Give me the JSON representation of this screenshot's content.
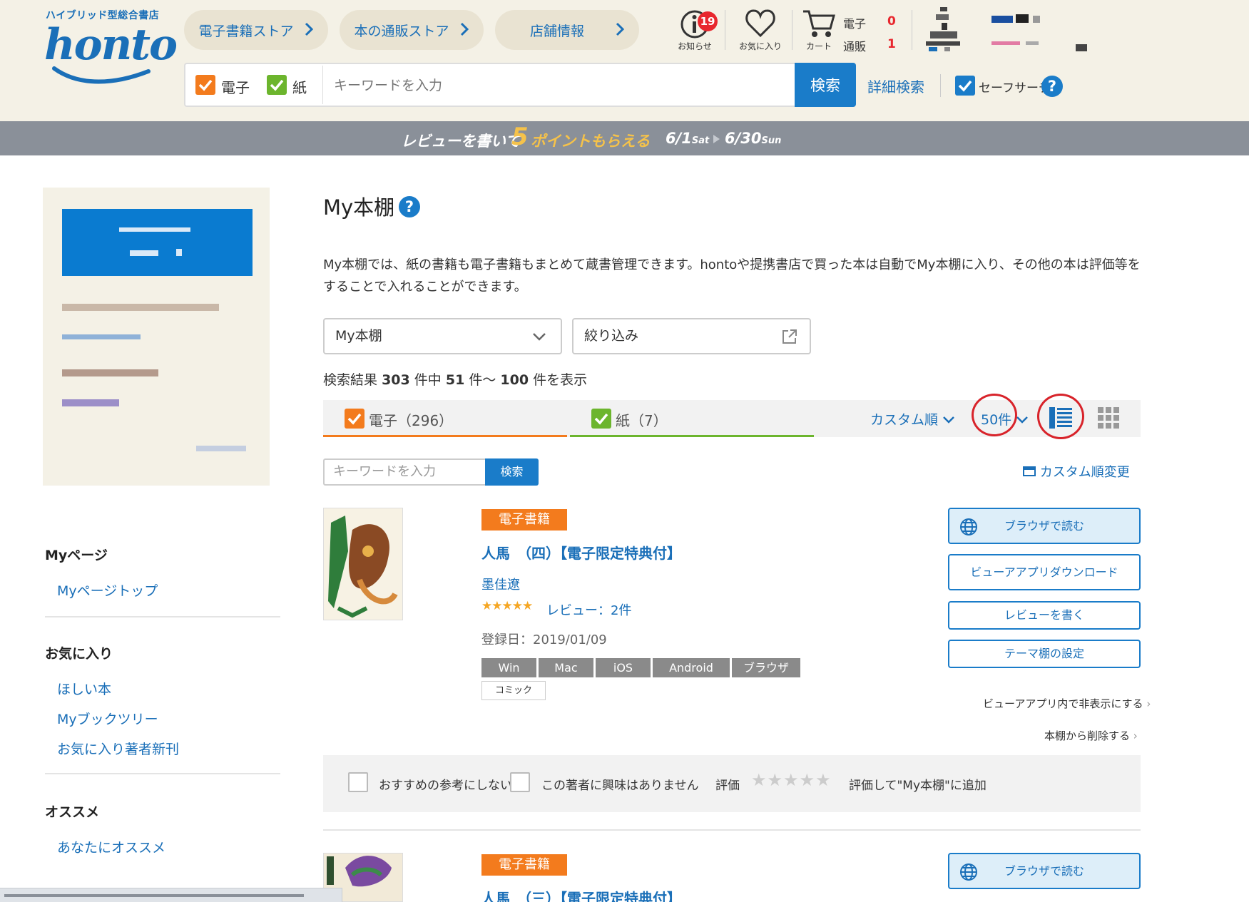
{
  "header": {
    "logo_sub": "ハイブリッド型総合書店",
    "logo": "honto",
    "nav": [
      {
        "label": "電子書籍ストア"
      },
      {
        "label": "本の通販ストア"
      },
      {
        "label": "店舗情報"
      }
    ],
    "notifications": {
      "label": "お知らせ",
      "count": "19"
    },
    "favorites": {
      "label": "お気に入り"
    },
    "cart": {
      "label": "カート",
      "ebook_label": "電子",
      "ebook_count": "0",
      "paper_label": "通販",
      "paper_count": "1"
    },
    "search": {
      "ebook_label": "電子",
      "paper_label": "紙",
      "placeholder": "キーワードを入力",
      "button": "検索",
      "advanced": "詳細検索",
      "safe_search": "セーフサーチ",
      "help": "?"
    }
  },
  "banner": {
    "text1": "レビューを書いて",
    "five": "5",
    "text2": "ポイントもらえる",
    "date1": "6/1",
    "date1_day": "Sat",
    "date2": "6/30",
    "date2_day": "Sun"
  },
  "sidebar": {
    "sections": [
      {
        "heading": "Myページ",
        "links": [
          "Myページトップ"
        ]
      },
      {
        "heading": "お気に入り",
        "links": [
          "ほしい本",
          "Myブックツリー",
          "お気に入り著者新刊"
        ]
      },
      {
        "heading": "オススメ",
        "links": [
          "あなたにオススメ"
        ]
      }
    ]
  },
  "main": {
    "title": "My本棚",
    "help": "?",
    "description": "My本棚では、紙の書籍も電子書籍もまとめて蔵書管理できます。hontoや提携書店で買った本は自動でMy本棚に入り、その他の本は評価等をすることで入れることができます。",
    "shelf_select": "My本棚",
    "filter_select": "絞り込み",
    "result": {
      "prefix": "検索結果",
      "total": "303",
      "mid": "件中",
      "from": "51",
      "mid2": "件～",
      "to": "100",
      "suffix": "件を表示"
    },
    "tabs": [
      {
        "label": "電子（296）",
        "color": "#f37b1d"
      },
      {
        "label": "紙（7）",
        "color": "#6cb52d"
      }
    ],
    "sort_label": "カスタム順",
    "per_page_label": "50件",
    "keyword_placeholder": "キーワードを入力",
    "keyword_button": "検索",
    "custom_change": "カスタム順変更"
  },
  "books": [
    {
      "type": "電子書籍",
      "title": "人馬　（四）【電子限定特典付】",
      "author": "墨佳遼",
      "stars": "★★★★★",
      "rating": 4.5,
      "reviews": "レビュー：2件",
      "registered": "登録日：2019/01/09",
      "platforms": [
        "Win",
        "Mac",
        "iOS",
        "Android",
        "ブラウザ"
      ],
      "genre": "コミック",
      "actions": [
        "ブラウザで読む",
        "ビューアアプリダウンロード",
        "レビューを書く",
        "テーマ棚の設定"
      ],
      "hide_link": "ビューアアプリ内で非表示にする",
      "remove_link": "本棚から削除する"
    },
    {
      "type": "電子書籍",
      "title": "人馬　（三）【電子限定特典付】",
      "actions": [
        "ブラウザで読む"
      ]
    }
  ],
  "feedback": {
    "no_recommend": "おすすめの参考にしない",
    "no_author": "この著者に興味はありません",
    "rating_label": "評価",
    "stars": "★★★★★",
    "add_label": "評価して\"My本棚\"に追加"
  },
  "colors": {
    "brand": "#1a6fb8",
    "accent": "#1a7cc9",
    "orange": "#f37b1d",
    "green": "#6cb52d",
    "highlight": "#d8232a"
  }
}
